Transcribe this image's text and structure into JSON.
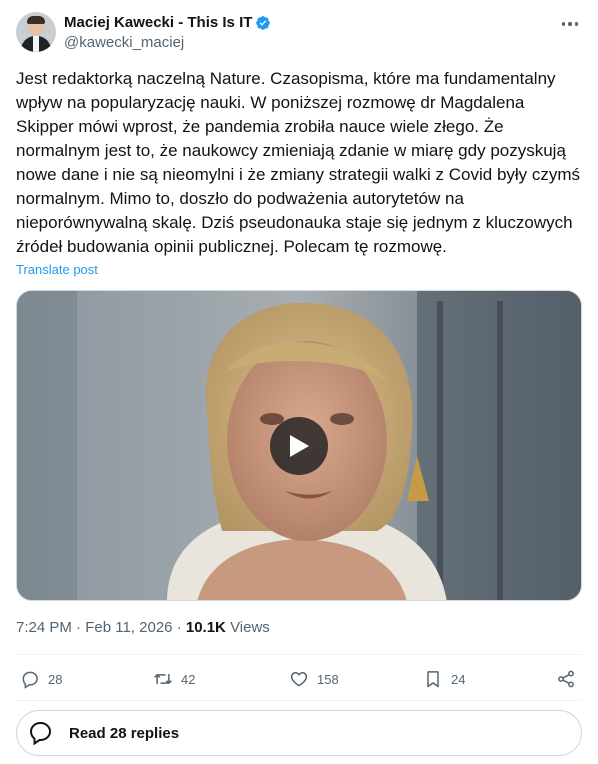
{
  "author": {
    "display_name": "Maciej Kawecki - This Is IT",
    "handle": "@kawecki_maciej",
    "verified": true
  },
  "post": {
    "text": "Jest redaktorką naczelną Nature. Czasopisma, które ma fundamentalny wpływ na popularyzację nauki. W poniższej rozmowę dr Magdalena Skipper mówi wprost, że pandemia zrobiła nauce wiele złego. Że normalnym jest to, że naukowcy zmieniają zdanie w miarę gdy pozyskują nowe dane i nie są nieomylni i że zmiany strategii walki z Covid były czymś normalnym. Mimo to, doszło do podważenia autorytetów na nieporównywalną skalę. Dziś pseudonauka staje się jednym z kluczowych źródeł budowania opinii publicznej. Polecam tę rozmowę.",
    "translate_label": "Translate post",
    "time": "7:24 PM",
    "date": "Feb 11, 2026",
    "views_count": "10.1K",
    "views_label": "Views"
  },
  "actions": {
    "replies": "28",
    "reposts": "42",
    "likes": "158",
    "bookmarks": "24"
  },
  "read_replies_label": "Read 28 replies",
  "colors": {
    "accent": "#1d9bf0",
    "text": "#0f1419",
    "secondary": "#536471"
  }
}
